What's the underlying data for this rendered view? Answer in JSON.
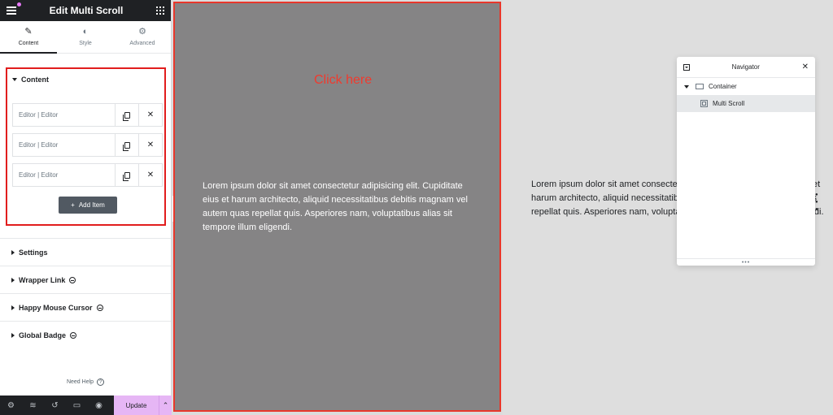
{
  "panel": {
    "title": "Edit Multi Scroll",
    "tabs": [
      {
        "label": "Content",
        "icon": "pencil-icon"
      },
      {
        "label": "Style",
        "icon": "half-circle-icon"
      },
      {
        "label": "Advanced",
        "icon": "gear-icon"
      }
    ],
    "content_section": {
      "title": "Content",
      "items": [
        {
          "label": "Editor | Editor"
        },
        {
          "label": "Editor | Editor"
        },
        {
          "label": "Editor | Editor"
        }
      ],
      "add_item_label": "Add Item"
    },
    "collapsed_sections": [
      {
        "label": "Settings",
        "badge": false
      },
      {
        "label": "Wrapper Link",
        "badge": true
      },
      {
        "label": "Happy Mouse Cursor",
        "badge": true
      },
      {
        "label": "Global Badge",
        "badge": true
      }
    ],
    "need_help": "Need Help",
    "footer": {
      "update_label": "Update"
    }
  },
  "canvas": {
    "click_here": "Click here",
    "lorem_left": "Lorem ipsum dolor sit amet consectetur adipisicing elit. Cupiditate eius et harum architecto, aliquid necessitatibus debitis magnam vel autem quas repellat quis. Asperiores nam, voluptatibus alias sit tempore illum eligendi.",
    "lorem_right": "Lorem ipsum dolor sit amet consectetur adipisicing elit. Cupiditate eius et harum architecto, aliquid necessitatibus debitis magnam vel autem quas repellat quis. Asperiores nam, voluptatibus alias sit tempore illum eligendi."
  },
  "navigator": {
    "title": "Navigator",
    "tree": {
      "container_label": "Container",
      "widget_label": "Multi Scroll"
    }
  },
  "colors": {
    "accent_update": "#e6b6f5",
    "selection_outline": "#e8372b",
    "click_here": "#f03a2e"
  }
}
